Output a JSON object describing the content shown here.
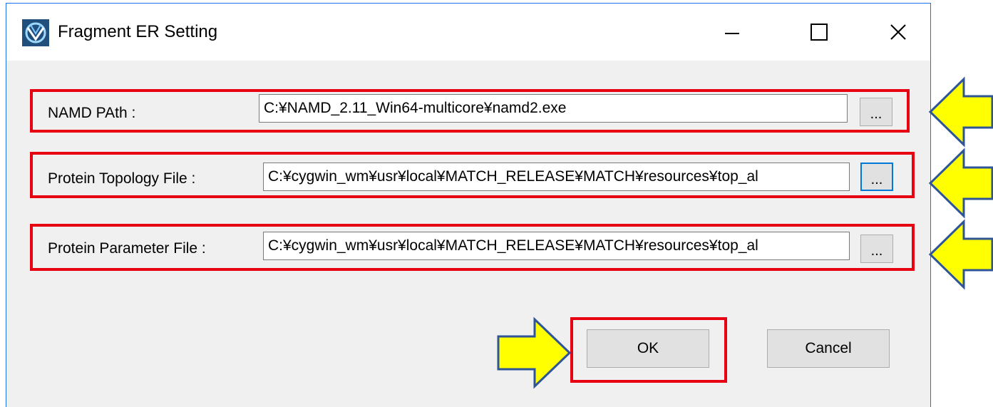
{
  "window": {
    "title": "Fragment ER Setting"
  },
  "fields": [
    {
      "label": "NAMD PAth :",
      "value": "C:¥NAMD_2.11_Win64-multicore¥namd2.exe",
      "browse_label": "..."
    },
    {
      "label": "Protein Topology File :",
      "value": "C:¥cygwin_wm¥usr¥local¥MATCH_RELEASE¥MATCH¥resources¥top_al",
      "browse_label": "..."
    },
    {
      "label": "Protein Parameter File :",
      "value": "C:¥cygwin_wm¥usr¥local¥MATCH_RELEASE¥MATCH¥resources¥top_al",
      "browse_label": "..."
    }
  ],
  "buttons": {
    "ok_label": "OK",
    "cancel_label": "Cancel"
  },
  "colors": {
    "highlight": "#e60012",
    "arrow_fill": "#ffff00",
    "arrow_stroke": "#2f5597",
    "focus": "#0078d7"
  }
}
